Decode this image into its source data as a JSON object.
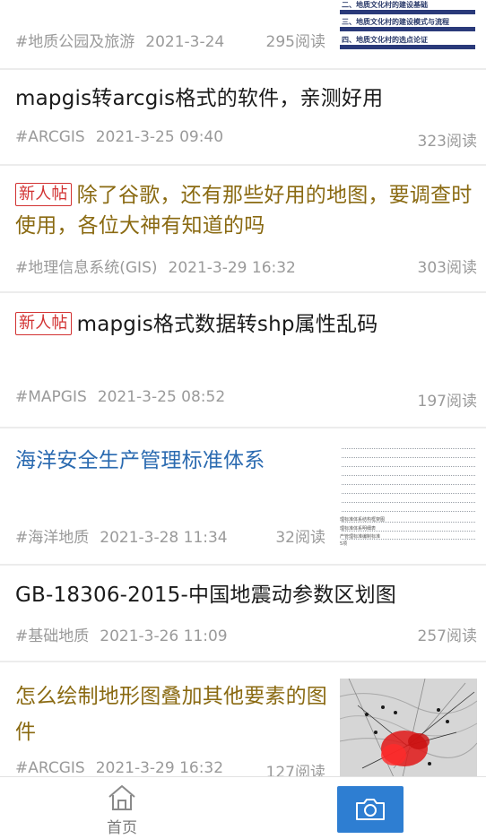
{
  "cards": [
    {
      "title": "",
      "tag": "#地质公园及旅游",
      "date": "2021-3-24",
      "reads": "295阅读",
      "thumb_doc_lines": [
        "二、地质文化村的建设基础",
        "三、地质文化村的建设模式与流程",
        "四、地质文化村的选点论证"
      ]
    },
    {
      "title": "mapgis转arcgis格式的软件，亲测好用",
      "tag": "#ARCGIS",
      "date": "2021-3-25 09:40",
      "reads": "323阅读"
    },
    {
      "badge": "新人帖",
      "title": "除了谷歌，还有那些好用的地图，要调查时使用，各位大神有知道的吗",
      "tag": "#地理信息系统(GIS)",
      "date": "2021-3-29 16:32",
      "reads": "303阅读"
    },
    {
      "badge": "新人帖",
      "title": "mapgis格式数据转shp属性乱码",
      "tag": "#MAPGIS",
      "date": "2021-3-25 08:52",
      "reads": "197阅读"
    },
    {
      "title": "海洋安全生产管理标准体系",
      "tag": "#海洋地质",
      "date": "2021-3-28 11:34",
      "reads": "32阅读",
      "thumb_text": [
        "理标准体系结构框架图",
        "理标准体系明细表",
        "产管理标准编制标准",
        "5项"
      ]
    },
    {
      "title": "GB-18306-2015-中国地震动参数区划图",
      "tag": "#基础地质",
      "date": "2021-3-26 11:09",
      "reads": "257阅读"
    },
    {
      "title": "怎么绘制地形图叠加其他要素的图件",
      "tag": "#ARCGIS",
      "date": "2021-3-29 16:32",
      "reads": "127阅读"
    }
  ],
  "tabbar": {
    "home_label": "首页",
    "home_icon": "home-icon",
    "camera_icon": "camera-icon"
  },
  "colors": {
    "gold_title": "#8a6a12",
    "blue_title": "#2a6ab0",
    "badge_red": "#d23232",
    "camera_button": "#2e7ed2"
  }
}
